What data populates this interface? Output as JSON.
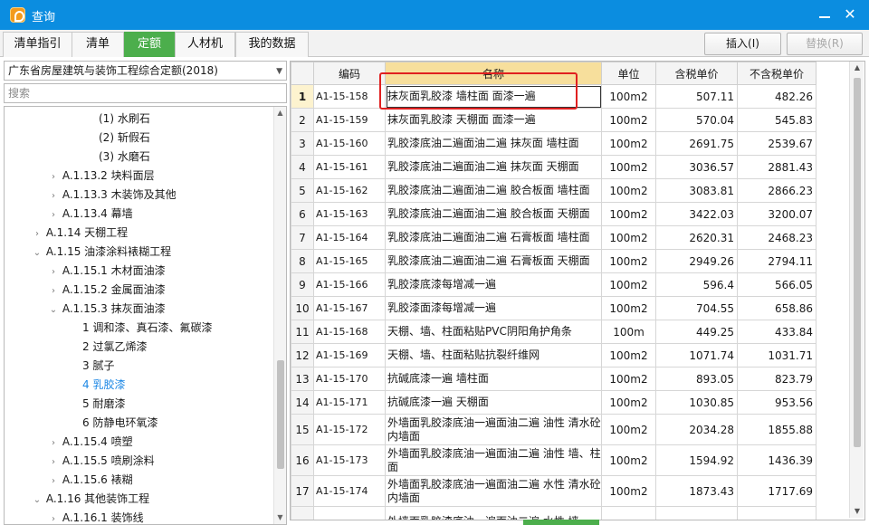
{
  "window": {
    "title": "查询",
    "close_glyph": "✕"
  },
  "tabs": [
    {
      "label": "清单指引",
      "active": false
    },
    {
      "label": "清单",
      "active": false
    },
    {
      "label": "定额",
      "active": true
    },
    {
      "label": "人材机",
      "active": false
    },
    {
      "label": "我的数据",
      "active": false
    }
  ],
  "toolbar": {
    "insert_label": "插入(I)",
    "replace_label": "替换(R)",
    "replace_enabled": false
  },
  "left_panel": {
    "quota_library": "广东省房屋建筑与装饰工程综合定额(2018)",
    "search_placeholder": "搜索",
    "tree": [
      {
        "label": "(1) 水刷石",
        "arrow": ""
      },
      {
        "label": "(2) 斩假石",
        "arrow": ""
      },
      {
        "label": "(3) 水磨石",
        "arrow": ""
      },
      {
        "label": "A.1.13.2 块料面层",
        "arrow": ">"
      },
      {
        "label": "A.1.13.3 木装饰及其他",
        "arrow": ">"
      },
      {
        "label": "A.1.13.4 幕墙",
        "arrow": ">"
      },
      {
        "label": "A.1.14 天棚工程",
        "arrow": ">"
      },
      {
        "label": "A.1.15 油漆涂料裱糊工程",
        "arrow": "v"
      },
      {
        "label": "A.1.15.1 木材面油漆",
        "arrow": ">"
      },
      {
        "label": "A.1.15.2 金属面油漆",
        "arrow": ">"
      },
      {
        "label": "A.1.15.3 抹灰面油漆",
        "arrow": "v"
      },
      {
        "label": "1 调和漆、真石漆、氟碳漆",
        "arrow": ""
      },
      {
        "label": "2 过氯乙烯漆",
        "arrow": ""
      },
      {
        "label": "3 腻子",
        "arrow": ""
      },
      {
        "label": "4 乳胶漆",
        "arrow": "",
        "selected": true
      },
      {
        "label": "5 耐磨漆",
        "arrow": ""
      },
      {
        "label": "6 防静电环氧漆",
        "arrow": ""
      },
      {
        "label": "A.1.15.4 喷塑",
        "arrow": ">"
      },
      {
        "label": "A.1.15.5 喷刷涂料",
        "arrow": ">"
      },
      {
        "label": "A.1.15.6 裱糊",
        "arrow": ">"
      },
      {
        "label": "A.1.16 其他装饰工程",
        "arrow": "v"
      },
      {
        "label": "A.1.16.1 装饰线",
        "arrow": ">"
      }
    ]
  },
  "grid": {
    "columns": [
      "编码",
      "名称",
      "单位",
      "含税单价",
      "不含税单价"
    ],
    "rows": [
      {
        "no": "1",
        "code": "A1-15-158",
        "name": "抹灰面乳胶漆 墙柱面 面漆一遍",
        "unit": "100m2",
        "tax_price": "507.11",
        "notax_price": "482.26"
      },
      {
        "no": "2",
        "code": "A1-15-159",
        "name": "抹灰面乳胶漆 天棚面 面漆一遍",
        "unit": "100m2",
        "tax_price": "570.04",
        "notax_price": "545.83"
      },
      {
        "no": "3",
        "code": "A1-15-160",
        "name": "乳胶漆底油二遍面油二遍 抹灰面 墙柱面",
        "unit": "100m2",
        "tax_price": "2691.75",
        "notax_price": "2539.67"
      },
      {
        "no": "4",
        "code": "A1-15-161",
        "name": "乳胶漆底油二遍面油二遍 抹灰面 天棚面",
        "unit": "100m2",
        "tax_price": "3036.57",
        "notax_price": "2881.43"
      },
      {
        "no": "5",
        "code": "A1-15-162",
        "name": "乳胶漆底油二遍面油二遍 胶合板面 墙柱面",
        "unit": "100m2",
        "tax_price": "3083.81",
        "notax_price": "2866.23"
      },
      {
        "no": "6",
        "code": "A1-15-163",
        "name": "乳胶漆底油二遍面油二遍 胶合板面 天棚面",
        "unit": "100m2",
        "tax_price": "3422.03",
        "notax_price": "3200.07"
      },
      {
        "no": "7",
        "code": "A1-15-164",
        "name": "乳胶漆底油二遍面油二遍 石膏板面 墙柱面",
        "unit": "100m2",
        "tax_price": "2620.31",
        "notax_price": "2468.23"
      },
      {
        "no": "8",
        "code": "A1-15-165",
        "name": "乳胶漆底油二遍面油二遍 石膏板面 天棚面",
        "unit": "100m2",
        "tax_price": "2949.26",
        "notax_price": "2794.11"
      },
      {
        "no": "9",
        "code": "A1-15-166",
        "name": "乳胶漆底漆每增减一遍",
        "unit": "100m2",
        "tax_price": "596.4",
        "notax_price": "566.05"
      },
      {
        "no": "10",
        "code": "A1-15-167",
        "name": "乳胶漆面漆每增减一遍",
        "unit": "100m2",
        "tax_price": "704.55",
        "notax_price": "658.86"
      },
      {
        "no": "11",
        "code": "A1-15-168",
        "name": "天棚、墙、柱面粘贴PVC阴阳角护角条",
        "unit": "100m",
        "tax_price": "449.25",
        "notax_price": "433.84"
      },
      {
        "no": "12",
        "code": "A1-15-169",
        "name": "天棚、墙、柱面粘贴抗裂纤维网",
        "unit": "100m2",
        "tax_price": "1071.74",
        "notax_price": "1031.71"
      },
      {
        "no": "13",
        "code": "A1-15-170",
        "name": "抗碱底漆一遍 墙柱面",
        "unit": "100m2",
        "tax_price": "893.05",
        "notax_price": "823.79"
      },
      {
        "no": "14",
        "code": "A1-15-171",
        "name": "抗碱底漆一遍 天棚面",
        "unit": "100m2",
        "tax_price": "1030.85",
        "notax_price": "953.56"
      },
      {
        "no": "15",
        "code": "A1-15-172",
        "name": "外墙面乳胶漆底油一遍面油二遍 油性 清水砼内墙面",
        "unit": "100m2",
        "tax_price": "2034.28",
        "notax_price": "1855.88"
      },
      {
        "no": "16",
        "code": "A1-15-173",
        "name": "外墙面乳胶漆底油一遍面油二遍 油性 墙、柱面",
        "unit": "100m2",
        "tax_price": "1594.92",
        "notax_price": "1436.39"
      },
      {
        "no": "17",
        "code": "A1-15-174",
        "name": "外墙面乳胶漆底油一遍面油二遍 水性 清水砼内墙面",
        "unit": "100m2",
        "tax_price": "1873.43",
        "notax_price": "1717.69"
      },
      {
        "no": "",
        "code": "",
        "name": "外墙面乳胶漆底油一遍面油二遍 水性 墙、",
        "unit": "",
        "tax_price": "",
        "notax_price": ""
      }
    ]
  },
  "colors": {
    "titlebar": "#0b8de0",
    "active_tab": "#4cae4c",
    "name_header": "#f7df9c",
    "selected_tree_item": "#1e88e5",
    "highlight_box": "#e02020"
  }
}
